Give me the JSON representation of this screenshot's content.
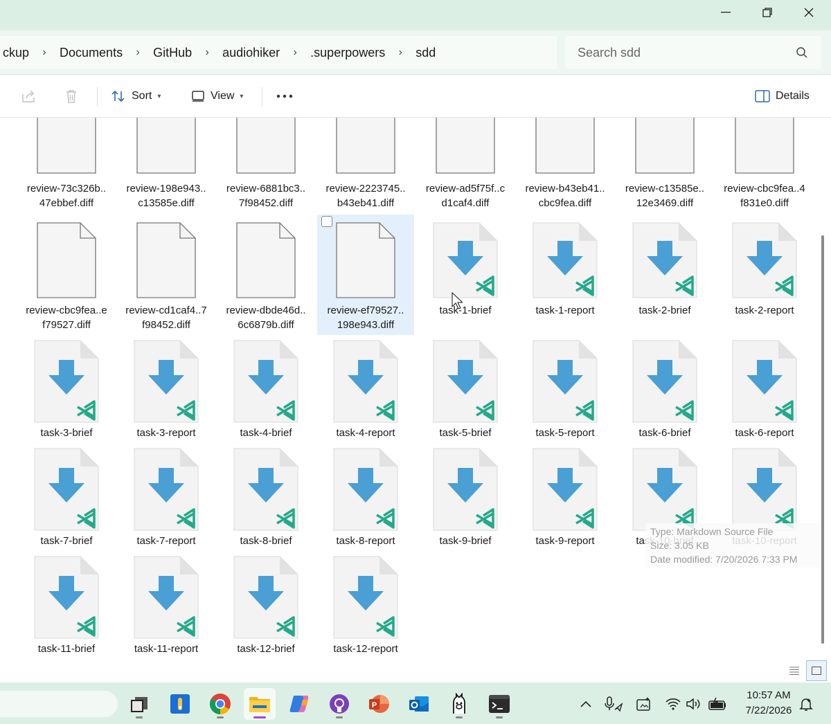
{
  "breadcrumb": [
    "ckup",
    "Documents",
    "GitHub",
    "audiohiker",
    ".superpowers",
    "sdd"
  ],
  "search": {
    "placeholder": "Search sdd"
  },
  "commandbar": {
    "sort": "Sort",
    "view": "View",
    "details": "Details"
  },
  "files": [
    {
      "name": "review-73c326b..\n47ebbef.diff",
      "kind": "diff"
    },
    {
      "name": "review-198e943..\nc13585e.diff",
      "kind": "diff"
    },
    {
      "name": "review-6881bc3..\n7f98452.diff",
      "kind": "diff"
    },
    {
      "name": "review-2223745..\nb43eb41.diff",
      "kind": "diff"
    },
    {
      "name": "review-ad5f75f..c\nd1caf4.diff",
      "kind": "diff"
    },
    {
      "name": "review-b43eb41..\ncbc9fea.diff",
      "kind": "diff"
    },
    {
      "name": "review-c13585e..\n12e3469.diff",
      "kind": "diff"
    },
    {
      "name": "review-cbc9fea..4\nf831e0.diff",
      "kind": "diff"
    },
    {
      "name": "review-cbc9fea..e\nf79527.diff",
      "kind": "diff"
    },
    {
      "name": "review-cd1caf4..7\nf98452.diff",
      "kind": "diff"
    },
    {
      "name": "review-dbde46d..\n6c6879b.diff",
      "kind": "diff"
    },
    {
      "name": "review-ef79527..\n198e943.diff",
      "kind": "diff",
      "selected": true
    },
    {
      "name": "task-1-brief",
      "kind": "md"
    },
    {
      "name": "task-1-report",
      "kind": "md"
    },
    {
      "name": "task-2-brief",
      "kind": "md"
    },
    {
      "name": "task-2-report",
      "kind": "md"
    },
    {
      "name": "task-3-brief",
      "kind": "md"
    },
    {
      "name": "task-3-report",
      "kind": "md"
    },
    {
      "name": "task-4-brief",
      "kind": "md"
    },
    {
      "name": "task-4-report",
      "kind": "md"
    },
    {
      "name": "task-5-brief",
      "kind": "md"
    },
    {
      "name": "task-5-report",
      "kind": "md"
    },
    {
      "name": "task-6-brief",
      "kind": "md"
    },
    {
      "name": "task-6-report",
      "kind": "md"
    },
    {
      "name": "task-7-brief",
      "kind": "md"
    },
    {
      "name": "task-7-report",
      "kind": "md"
    },
    {
      "name": "task-8-brief",
      "kind": "md"
    },
    {
      "name": "task-8-report",
      "kind": "md"
    },
    {
      "name": "task-9-brief",
      "kind": "md"
    },
    {
      "name": "task-9-report",
      "kind": "md"
    },
    {
      "name": "task-10-brief",
      "kind": "md"
    },
    {
      "name": "task-10-report",
      "kind": "md"
    },
    {
      "name": "task-11-brief",
      "kind": "md"
    },
    {
      "name": "task-11-report",
      "kind": "md"
    },
    {
      "name": "task-12-brief",
      "kind": "md"
    },
    {
      "name": "task-12-report",
      "kind": "md"
    }
  ],
  "tooltip": {
    "type": "Type: Markdown Source File",
    "size": "Size: 3.05 KB",
    "modified": "Date modified: 7/20/2026 7:33 PM"
  },
  "taskbar": {
    "apps": [
      "task-view-icon",
      "notepad-icon",
      "chrome-icon",
      "file-explorer-icon",
      "copilot-icon",
      "github-desktop-icon",
      "powerpoint-icon",
      "outlook-icon",
      "ollama-icon",
      "terminal-icon"
    ],
    "time": "10:57 AM",
    "date": "7/22/2026"
  },
  "colors": {
    "accent": "#4a9fd4",
    "vscode": "#23a98b",
    "selection": "#e3f0fb",
    "titlebar": "#dcefe4"
  }
}
